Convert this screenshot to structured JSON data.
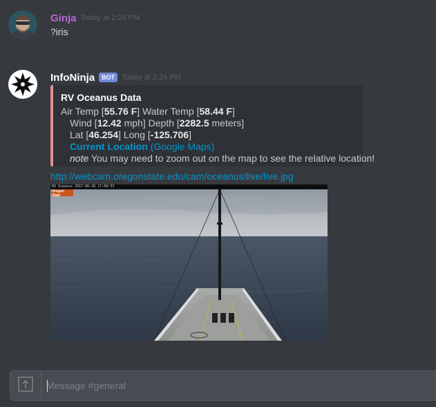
{
  "messages": [
    {
      "author": "Ginja",
      "timestamp": "Today at 2:24 PM",
      "content": "?iris",
      "avatar_icon": "user-photo-avatar"
    },
    {
      "author": "InfoNinja",
      "bot_tag": "BOT",
      "timestamp": "Today at 2:24 PM",
      "avatar_icon": "ninja-star-avatar",
      "embed": {
        "accent_color": "#e68d8f",
        "title": "RV Oceanus Data",
        "air_temp_label": "Air Temp [",
        "air_temp_value": "55.76 F",
        "water_temp_label": "] Water Temp [",
        "water_temp_value": "58.44 F",
        "close_bracket": "]",
        "wind_label": "Wind [",
        "wind_value": "12.42",
        "wind_unit": " mph] Depth [",
        "depth_value": "2282.5",
        "depth_unit": " meters]",
        "lat_label": "Lat [",
        "lat_value": "46.254",
        "long_label": "] Long [",
        "long_value": "-125.706",
        "location_link": "Current Location",
        "maps_link": "(Google Maps)",
        "note_label": "note",
        "note_text": " You may need to zoom out on the map to see the relative location!"
      },
      "url": "http://webcam.oregonstate.edu/cam/oceanus/live/live.jpg",
      "image": {
        "camera_stamp": "RV Oceanus 2017-06-26 17:08:33",
        "logo_text": "Oregon State"
      }
    }
  ],
  "composer": {
    "placeholder": "Message #general",
    "upload_icon": "upload-arrow-icon"
  },
  "colors": {
    "background": "#36393e",
    "ginja_name": "#b56bd1",
    "bot_tag": "#7289da",
    "link": "#0096cf"
  }
}
